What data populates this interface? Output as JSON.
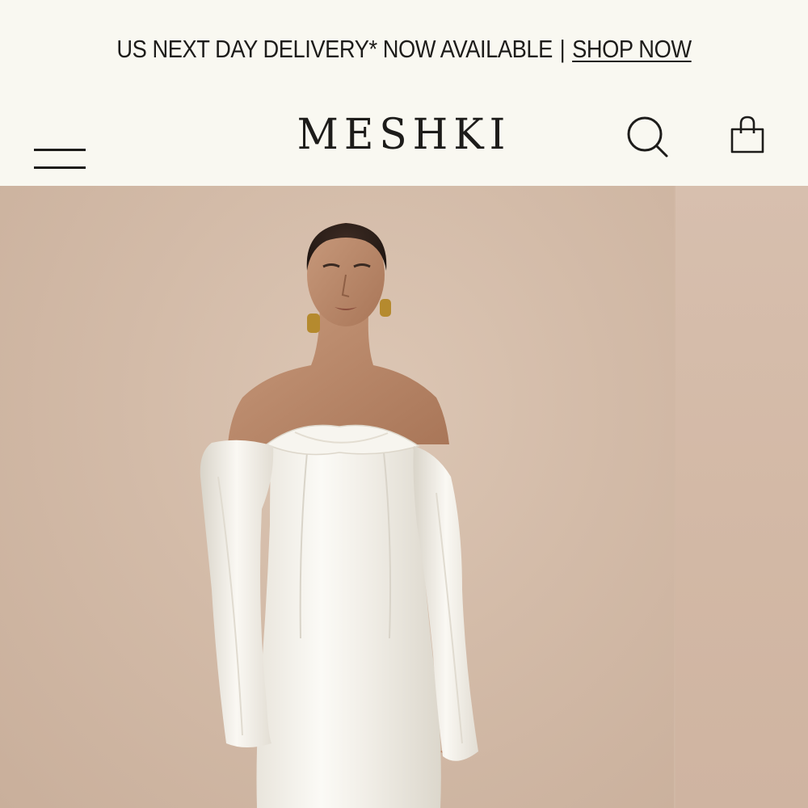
{
  "announcement": {
    "text": "US NEXT DAY DELIVERY* NOW AVAILABLE",
    "separator": "|",
    "link_label": "SHOP NOW"
  },
  "header": {
    "logo": "MESHKI",
    "icons": [
      "menu-icon",
      "search-icon",
      "shopping-bag-icon"
    ]
  },
  "hero": {
    "image": "model wearing white satin off-shoulder long-sleeve maxi dress",
    "carousel_peek": "next slide partially visible"
  },
  "colors": {
    "page_background": "#f9f8f1",
    "text": "#1d1c1a",
    "hero_background": "#d3bba8",
    "dress": "#f4f1ea"
  }
}
